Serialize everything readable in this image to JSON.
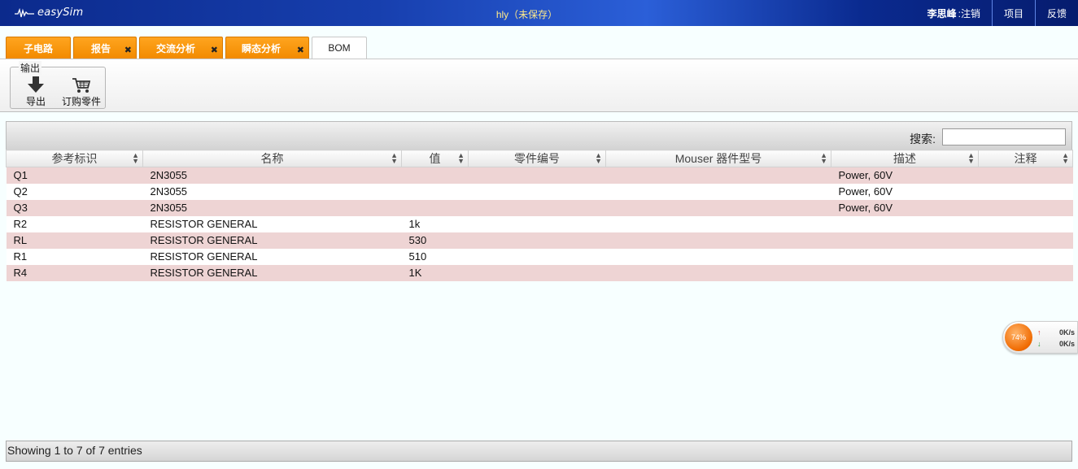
{
  "header": {
    "logo_text": "easySim",
    "doc_title": "hly（未保存）",
    "user_name": "李思峰",
    "logout_label": ":注销",
    "links": [
      "项目",
      "反馈"
    ]
  },
  "tabs": [
    {
      "label": "子电路",
      "closable": false
    },
    {
      "label": "报告",
      "closable": true
    },
    {
      "label": "交流分析",
      "closable": true
    },
    {
      "label": "瞬态分析",
      "closable": true
    },
    {
      "label": "BOM",
      "closable": false,
      "active": true
    }
  ],
  "toolbar": {
    "group_label": "输出",
    "export_label": "导出",
    "order_label": "订购零件"
  },
  "search": {
    "label": "搜索:",
    "value": ""
  },
  "table": {
    "columns": [
      "参考标识",
      "名称",
      "值",
      "零件编号",
      "Mouser 器件型号",
      "描述",
      "注释"
    ],
    "rows": [
      [
        "Q1",
        "2N3055",
        "",
        "",
        "",
        "Power, 60V",
        ""
      ],
      [
        "Q2",
        "2N3055",
        "",
        "",
        "",
        "Power, 60V",
        ""
      ],
      [
        "Q3",
        "2N3055",
        "",
        "",
        "",
        "Power, 60V",
        ""
      ],
      [
        "R2",
        "RESISTOR GENERAL",
        "1k",
        "",
        "",
        "",
        ""
      ],
      [
        "RL",
        "RESISTOR GENERAL",
        "530",
        "",
        "",
        "",
        ""
      ],
      [
        "R1",
        "RESISTOR GENERAL",
        "510",
        "",
        "",
        "",
        ""
      ],
      [
        "R4",
        "RESISTOR GENERAL",
        "1K",
        "",
        "",
        "",
        ""
      ]
    ]
  },
  "footer": {
    "info": "Showing 1 to 7 of 7 entries"
  },
  "speed_widget": {
    "percent": "74%",
    "up": "0K/s",
    "down": "0K/s"
  },
  "colors": {
    "tab_orange": "#f7960f",
    "row_odd": "#eed4d4",
    "header_blue": "#173fae"
  }
}
